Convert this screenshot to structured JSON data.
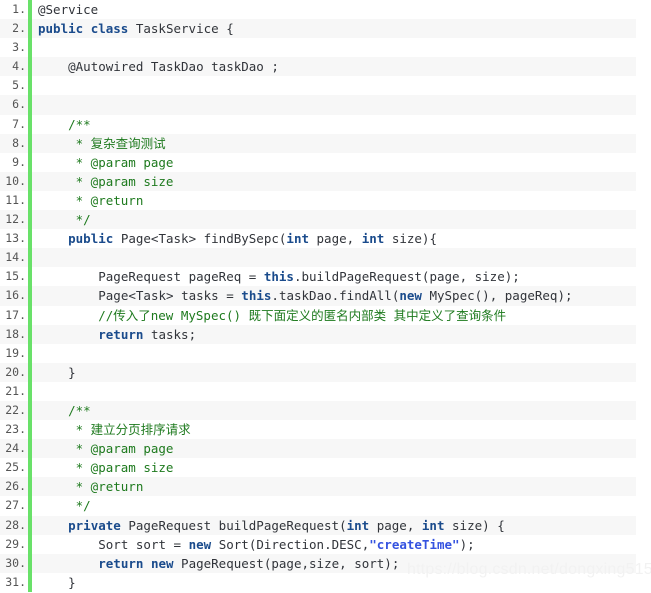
{
  "editor": {
    "language": "java",
    "first_line_number": 1,
    "last_line_number": 31,
    "gutter_bar_color": "#69e169",
    "stripe_color": "#f7f7f7",
    "background_color": "#ffffff",
    "keyword_color": "#1a4b8c",
    "comment_color": "#1e7a1e",
    "string_color": "#3452e0",
    "text_color": "#31343a",
    "line_number_color": "#555555"
  },
  "watermark": {
    "text": "https://blog.csdn.net/dongxing515",
    "color": "#f2f2f2"
  },
  "lines": [
    {
      "n": "1.",
      "text": "@Service"
    },
    {
      "n": "2.",
      "text": "public class TaskService {"
    },
    {
      "n": "3.",
      "text": ""
    },
    {
      "n": "4.",
      "text": "    @Autowired TaskDao taskDao ;"
    },
    {
      "n": "5.",
      "text": ""
    },
    {
      "n": "6.",
      "text": ""
    },
    {
      "n": "7.",
      "text": "    /**"
    },
    {
      "n": "8.",
      "text": "     * 复杂查询测试"
    },
    {
      "n": "9.",
      "text": "     * @param page"
    },
    {
      "n": "10.",
      "text": "     * @param size"
    },
    {
      "n": "11.",
      "text": "     * @return"
    },
    {
      "n": "12.",
      "text": "     */"
    },
    {
      "n": "13.",
      "text": "    public Page<Task> findBySepc(int page, int size){"
    },
    {
      "n": "14.",
      "text": ""
    },
    {
      "n": "15.",
      "text": "        PageRequest pageReq = this.buildPageRequest(page, size);"
    },
    {
      "n": "16.",
      "text": "        Page<Task> tasks = this.taskDao.findAll(new MySpec(), pageReq);"
    },
    {
      "n": "17.",
      "text": "        //传入了new MySpec() 既下面定义的匿名内部类 其中定义了查询条件"
    },
    {
      "n": "18.",
      "text": "        return tasks;"
    },
    {
      "n": "19.",
      "text": ""
    },
    {
      "n": "20.",
      "text": "    }"
    },
    {
      "n": "21.",
      "text": ""
    },
    {
      "n": "22.",
      "text": "    /**"
    },
    {
      "n": "23.",
      "text": "     * 建立分页排序请求"
    },
    {
      "n": "24.",
      "text": "     * @param page"
    },
    {
      "n": "25.",
      "text": "     * @param size"
    },
    {
      "n": "26.",
      "text": "     * @return"
    },
    {
      "n": "27.",
      "text": "     */"
    },
    {
      "n": "28.",
      "text": "    private PageRequest buildPageRequest(int page, int size) {"
    },
    {
      "n": "29.",
      "text": "        Sort sort = new Sort(Direction.DESC,\"createTime\");"
    },
    {
      "n": "30.",
      "text": "        return new PageRequest(page,size, sort);"
    },
    {
      "n": "31.",
      "text": "    }"
    }
  ],
  "highlight": {
    "keywords": [
      "public",
      "class",
      "private",
      "this",
      "new",
      "return",
      "int"
    ],
    "comment_lines": [
      7,
      8,
      9,
      10,
      11,
      12,
      17,
      22,
      23,
      24,
      25,
      26,
      27
    ],
    "strings": [
      "\"createTime\""
    ]
  }
}
